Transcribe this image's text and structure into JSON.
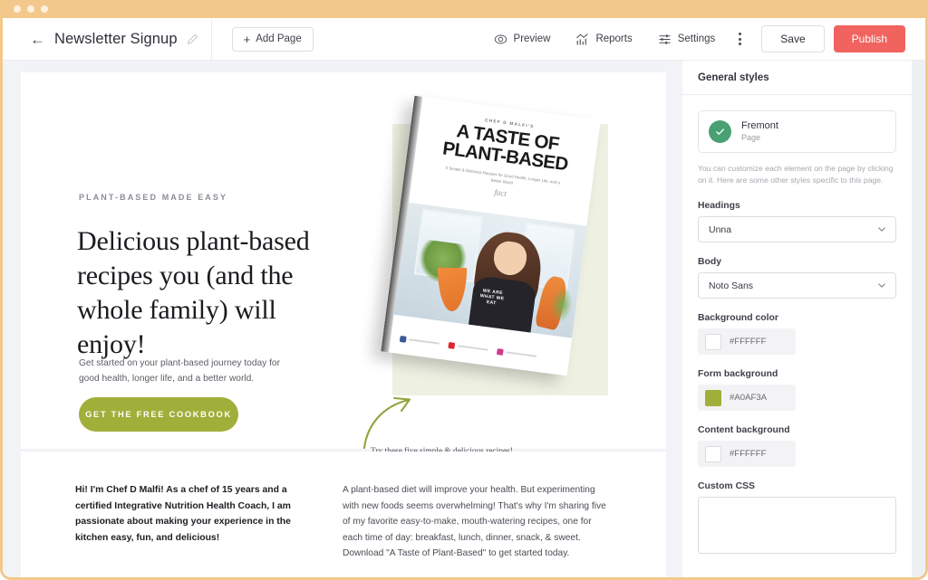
{
  "titlebar": {
    "dots": 3
  },
  "toolbar": {
    "back_icon": "back-arrow-icon",
    "page_title": "Newsletter Signup",
    "edit_icon": "pencil-icon",
    "add_page_label": "Add Page",
    "add_page_plus": "+",
    "items": [
      {
        "label": "Preview",
        "icon": "eye-icon"
      },
      {
        "label": "Reports",
        "icon": "bar-chart-icon"
      },
      {
        "label": "Settings",
        "icon": "sliders-icon"
      }
    ],
    "more_icon": "kebab-menu-icon",
    "save_label": "Save",
    "publish_label": "Publish",
    "publish_color": "#F1635E"
  },
  "canvas": {
    "hero": {
      "eyebrow": "PLANT-BASED MADE EASY",
      "headline": "Delicious plant-based recipes you (and the whole family) will enjoy!",
      "subcopy": "Get started on your plant-based journey today for good health, longer life, and a better world.",
      "cta_label": "GET THE FREE COOKBOOK",
      "cta_color": "#A0AF3A",
      "caption": "Try these five simple & delicious recipes!",
      "arrow_icon": "curved-arrow-icon",
      "arrow_color": "#8FA53C"
    },
    "book": {
      "author_line": "CHEF D MALFI'S",
      "title_line_1": "A TASTE OF",
      "title_line_2": "PLANT-BASED",
      "subtitle": "5 Simple & Delicious Recipes for Good Health, Longer Life, and a Better World",
      "script_mark": "fact",
      "shirt_text": "WE ARE WHAT WE EAT",
      "badge_colors": [
        "#3b5998",
        "#e0262b",
        "#d23b8f"
      ]
    },
    "bottom_columns": [
      {
        "text": "Hi! I'm Chef D Malfi! As a chef of 15 years and a certified Integrative Nutrition Health Coach, I am passionate about making your experience in the kitchen easy, fun, and delicious!"
      },
      {
        "text": "A plant-based diet will improve your health. But experimenting with new foods seems overwhelming! That's why I'm sharing five of my favorite easy-to-make, mouth-watering recipes, one for each time of day: breakfast, lunch, dinner, snack, & sweet. Download \"A Taste of Plant-Based\" to get started today."
      }
    ]
  },
  "panel": {
    "heading": "General styles",
    "theme": {
      "name": "Fremont",
      "subtitle": "Page",
      "check_icon": "check-circle-icon",
      "check_color": "#48A073"
    },
    "helper_text": "You can customize each element on the page by clicking on it. Here are some other styles specific to this page.",
    "fields": {
      "headings_label": "Headings",
      "headings_value": "Unna",
      "body_label": "Body",
      "body_value": "Noto Sans",
      "background_color_label": "Background color",
      "background_color_value": "#FFFFFF",
      "form_background_label": "Form background",
      "form_background_value": "#A0AF3A",
      "content_background_label": "Content background",
      "content_background_value": "#FFFFFF",
      "custom_css_label": "Custom CSS",
      "custom_css_value": ""
    },
    "chevron_icon": "chevron-down-icon"
  }
}
